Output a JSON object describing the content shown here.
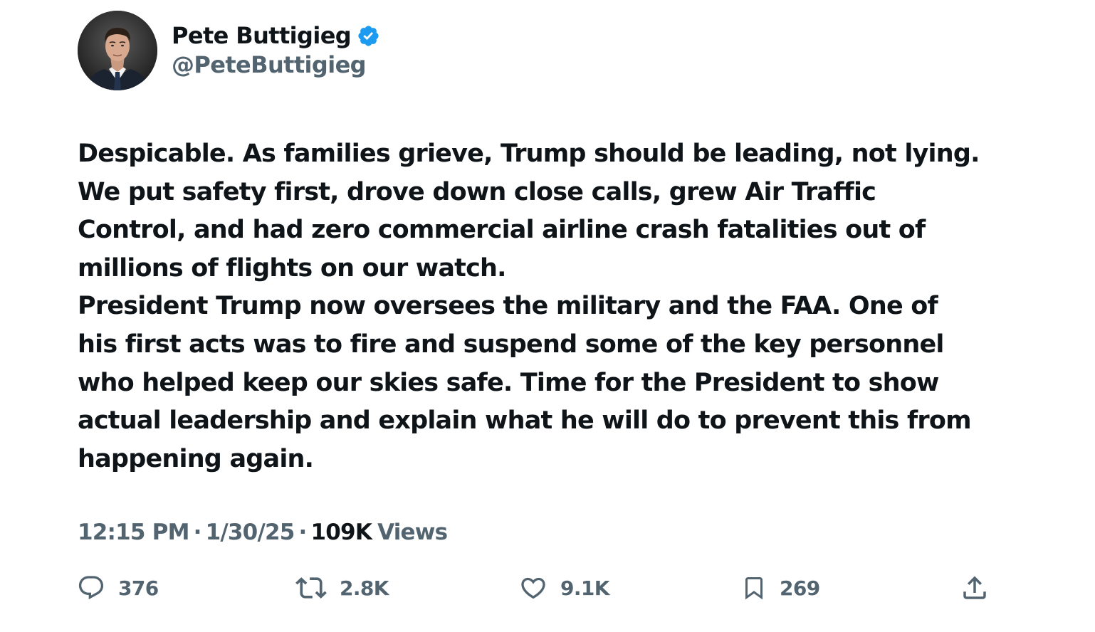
{
  "author": {
    "display_name": "Pete Buttigieg",
    "handle": "@PeteButtigieg",
    "verified": true,
    "verified_color": "#1d9bf0"
  },
  "tweet": {
    "lines": [
      "Despicable. As families grieve, Trump should be leading, not lying.",
      "We put safety first, drove down close calls, grew Air Traffic",
      "Control, and had zero commercial airline crash fatalities out of",
      "millions of flights on our watch.",
      "President Trump now oversees the military and the FAA. One of",
      "his first acts was to fire and suspend some of the key personnel",
      "who helped keep our skies safe. Time for the President to show",
      "actual leadership and explain what he will do to prevent this from",
      "happening again."
    ]
  },
  "meta": {
    "time": "12:15 PM",
    "separator": "·",
    "date": "1/30/25",
    "views_count": "109K",
    "views_label": "Views"
  },
  "actions": {
    "replies": {
      "icon": "reply-icon",
      "count": "376"
    },
    "retweets": {
      "icon": "retweet-icon",
      "count": "2.8K"
    },
    "likes": {
      "icon": "heart-icon",
      "count": "9.1K"
    },
    "bookmarks": {
      "icon": "bookmark-icon",
      "count": "269"
    },
    "share": {
      "icon": "share-icon"
    }
  },
  "colors": {
    "primary_text": "#0f1419",
    "secondary_text": "#536471",
    "background": "#ffffff"
  }
}
